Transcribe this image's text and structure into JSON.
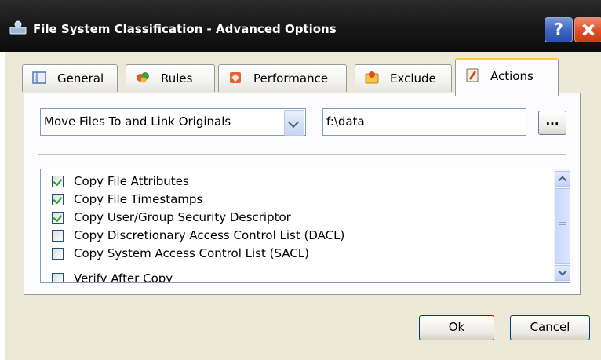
{
  "window": {
    "title": "File System Classification - Advanced Options",
    "help_label": "?"
  },
  "tabs": [
    {
      "label": "General",
      "icon": "general-icon"
    },
    {
      "label": "Rules",
      "icon": "rules-icon"
    },
    {
      "label": "Performance",
      "icon": "performance-icon"
    },
    {
      "label": "Exclude",
      "icon": "exclude-icon"
    },
    {
      "label": "Actions",
      "icon": "actions-icon",
      "active": true
    }
  ],
  "actions": {
    "mode_select": {
      "selected": "Move Files To and Link Originals"
    },
    "target_path": "f:\\data",
    "browse_label": "...",
    "options": [
      {
        "label": "Copy File Attributes",
        "checked": true
      },
      {
        "label": "Copy File Timestamps",
        "checked": true
      },
      {
        "label": "Copy User/Group Security Descriptor",
        "checked": true
      },
      {
        "label": "Copy Discretionary Access Control List (DACL)",
        "checked": false
      },
      {
        "label": "Copy System Access Control List (SACL)",
        "checked": false
      },
      {
        "label": "Verify After Copy",
        "checked": false
      }
    ]
  },
  "buttons": {
    "ok": "Ok",
    "cancel": "Cancel"
  },
  "colors": {
    "titlebar": "#1a1a1a",
    "dialog": "#ece9d8",
    "active_tab_accent": "#ffc83c",
    "close": "#df4d25",
    "help": "#3e62c2"
  }
}
